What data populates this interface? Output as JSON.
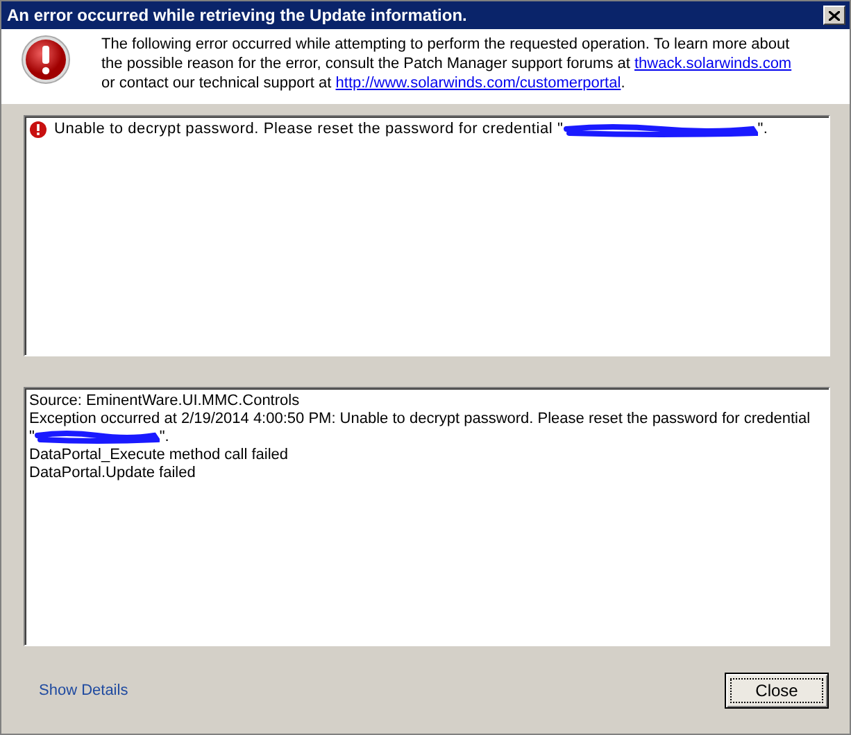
{
  "window": {
    "title": "An error occurred while retrieving the Update information."
  },
  "header": {
    "message": [
      {
        "kind": "text",
        "text": "The following error occurred while attempting to perform the requested operation. To learn more about the possible reason for the error, consult the Patch Manager support forums at "
      },
      {
        "kind": "link",
        "text": "thwack.solarwinds.com"
      },
      {
        "kind": "text",
        "text": " or contact our technical support at "
      },
      {
        "kind": "link",
        "text": "http://www.solarwinds.com/customerportal"
      },
      {
        "kind": "text",
        "text": "."
      }
    ]
  },
  "errors": [
    {
      "before": "Unable to decrypt password. Please reset the password for credential \"",
      "redacted": true,
      "after": "\"."
    }
  ],
  "details": [
    {
      "before": "Source: EminentWare.UI.MMC.Controls",
      "redacted": false
    },
    {
      "before": "Exception occurred at 2/19/2014 4:00:50 PM: Unable to decrypt password. Please reset the password for credential",
      "redacted": false
    },
    {
      "before": "\"",
      "redacted": true,
      "after": "\"."
    },
    {
      "before": "DataPortal_Execute method call failed",
      "redacted": false
    },
    {
      "before": "DataPortal.Update failed",
      "redacted": false
    }
  ],
  "footer": {
    "show_details": "Show Details",
    "close_button": "Close"
  }
}
